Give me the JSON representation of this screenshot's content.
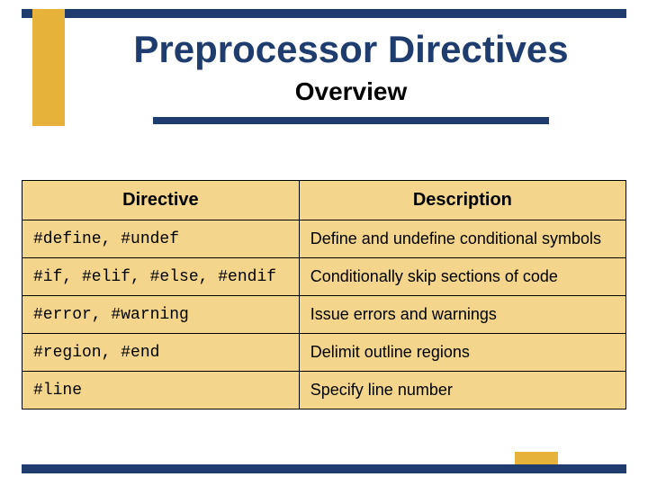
{
  "header": {
    "title": "Preprocessor Directives",
    "subtitle": "Overview"
  },
  "table": {
    "columns": [
      "Directive",
      "Description"
    ],
    "rows": [
      {
        "directive": "#define, #undef",
        "description": "Define and undefine conditional symbols"
      },
      {
        "directive": "#if, #elif, #else, #endif",
        "description": "Conditionally skip sections of code"
      },
      {
        "directive": "#error, #warning",
        "description": "Issue errors and warnings"
      },
      {
        "directive": "#region, #end",
        "description": "Delimit outline regions"
      },
      {
        "directive": "#line",
        "description": "Specify line number"
      }
    ]
  }
}
